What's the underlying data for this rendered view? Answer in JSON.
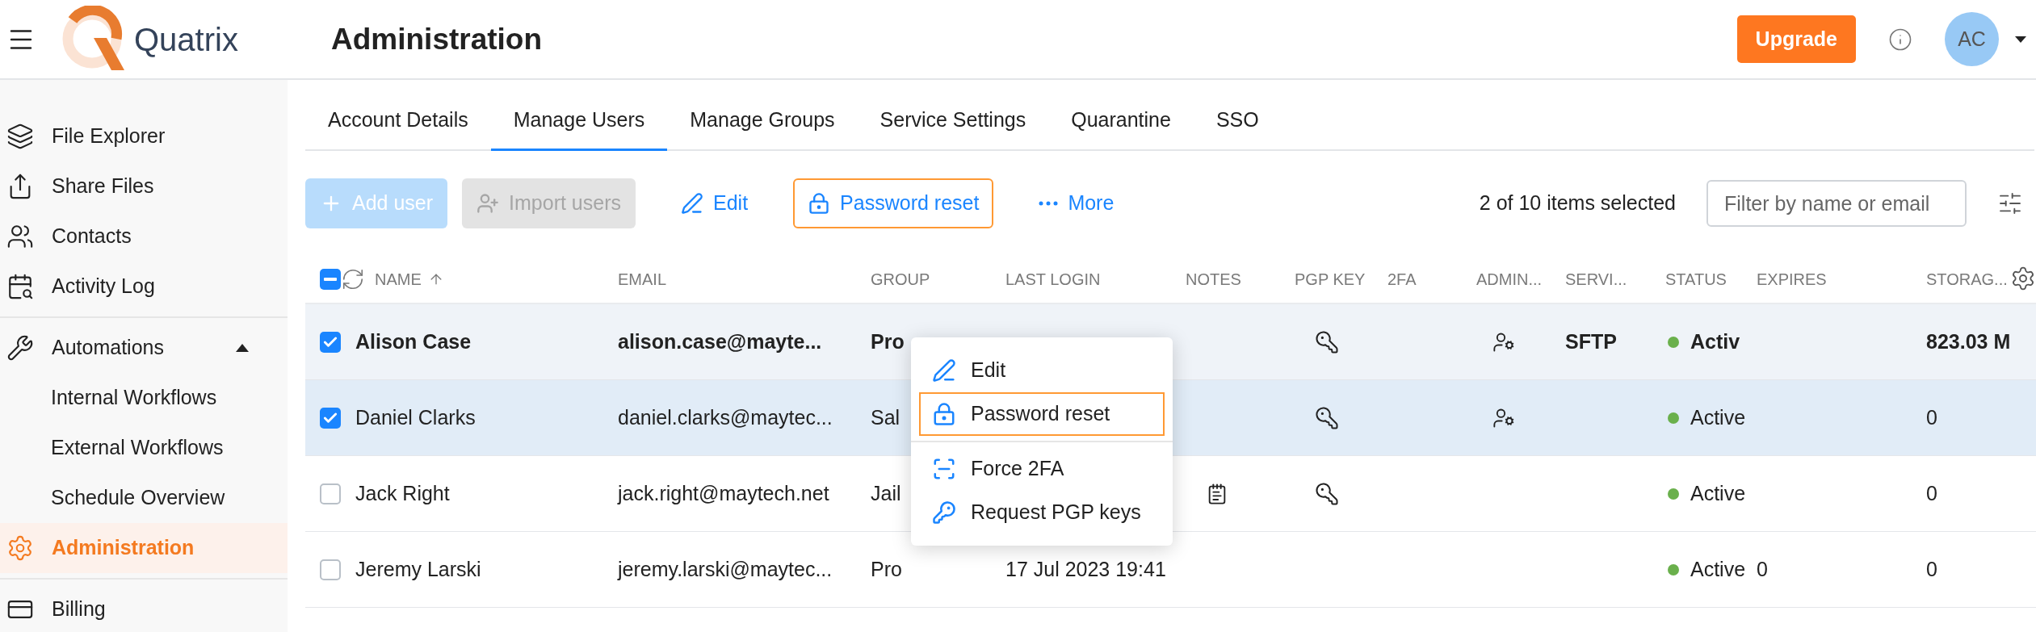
{
  "header": {
    "logo_text": "Quatrix",
    "title": "Administration",
    "upgrade_button": "Upgrade",
    "avatar": "AC"
  },
  "sidebar": {
    "groups": [
      {
        "items": [
          {
            "label": "File Explorer",
            "selected": false
          },
          {
            "label": "Share Files",
            "selected": false
          },
          {
            "label": "Contacts",
            "selected": false
          },
          {
            "label": "Activity Log",
            "selected": false
          }
        ]
      },
      {
        "items": [
          {
            "label": "Automations",
            "selected": false,
            "expanded": true,
            "children": [
              {
                "label": "Internal Workflows",
                "selected": false
              },
              {
                "label": "External Workflows",
                "selected": false
              },
              {
                "label": "Schedule Overview",
                "selected": false
              }
            ]
          },
          {
            "label": "Administration",
            "selected": true
          }
        ]
      },
      {
        "items": [
          {
            "label": "Billing",
            "selected": false
          }
        ]
      }
    ]
  },
  "tabs": [
    {
      "label": "Account Details",
      "selected": false
    },
    {
      "label": "Manage Users",
      "selected": true
    },
    {
      "label": "Manage Groups",
      "selected": false
    },
    {
      "label": "Service Settings",
      "selected": false
    },
    {
      "label": "Quarantine",
      "selected": false
    },
    {
      "label": "SSO",
      "selected": false
    }
  ],
  "toolbar": {
    "buttons": [
      {
        "kind": "primary",
        "label": "Add user",
        "disabled": true,
        "highlighted": false
      },
      {
        "kind": "secondary",
        "label": "Import users",
        "disabled": true,
        "highlighted": false
      },
      {
        "kind": "edit",
        "label": "Edit",
        "disabled": false,
        "highlighted": false
      },
      {
        "kind": "reset",
        "label": "Password reset",
        "disabled": false,
        "highlighted": true
      },
      {
        "kind": "more",
        "label": "More",
        "disabled": false,
        "highlighted": false
      }
    ],
    "selection_count": "2 of 10 items selected",
    "filter": {
      "placeholder": "Filter by name or email"
    }
  },
  "table": {
    "columns": [
      "NAME",
      "EMAIL",
      "GROUP",
      "LAST LOGIN",
      "NOTES",
      "PGP KEY",
      "2FA",
      "ADMIN...",
      "SERVI...",
      "STATUS",
      "EXPIRES",
      "STORAG..."
    ],
    "header_checkbox": {
      "checked": true,
      "indeterminate": true
    },
    "rows": [
      {
        "selected": true,
        "hovered": true,
        "name": "Alison Case",
        "email": "alison.case@mayte...",
        "group": "Pro",
        "notes": false,
        "pgp_key": true,
        "admin": true,
        "service": "SFTP",
        "status": "Activ",
        "color": "#6ab04c",
        "storage": "823.03 M"
      },
      {
        "selected": true,
        "hovered": false,
        "name": "Daniel Clarks",
        "email": "daniel.clarks@maytec...",
        "group": "Sal",
        "notes": false,
        "pgp_key": true,
        "admin": true,
        "status": "Active",
        "color": "#6ab04c",
        "storage": "0"
      },
      {
        "selected": false,
        "hovered": false,
        "name": "Jack Right",
        "email": "jack.right@maytech.net",
        "group": "Jail",
        "notes": true,
        "pgp_key": true,
        "admin": false,
        "status": "Active",
        "color": "#6ab04c",
        "storage": "0"
      },
      {
        "selected": false,
        "hovered": false,
        "name": "Jeremy Larski",
        "email": "jeremy.larski@maytec...",
        "group": "Pro",
        "last_login": "17 Jul 2023 19:41",
        "notes": false,
        "pgp_key": false,
        "admin": false,
        "status": "Active",
        "color": "#6ab04c",
        "expires": "0",
        "storage": "0"
      }
    ]
  },
  "context_menu": {
    "items": [
      {
        "kind": "edit",
        "label": "Edit",
        "highlighted": false
      },
      {
        "kind": "reset",
        "label": "Password reset",
        "highlighted": true
      },
      {
        "kind": "twofa",
        "label": "Force 2FA",
        "highlighted": false
      },
      {
        "kind": "pgp",
        "label": "Request PGP keys",
        "highlighted": false
      }
    ]
  }
}
